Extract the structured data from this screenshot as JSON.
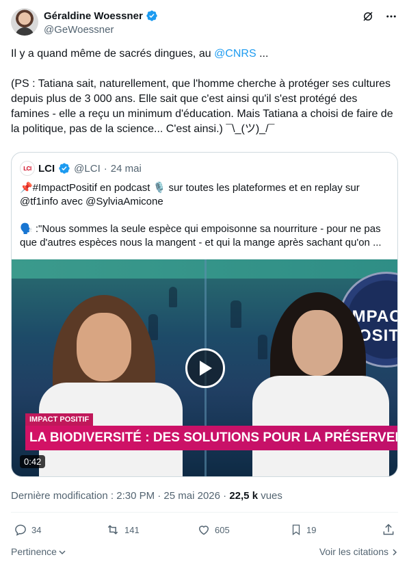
{
  "author": {
    "name": "Géraldine Woessner",
    "handle": "@GeWoessner"
  },
  "tweet": {
    "text_prefix": "Il y a quand même de sacrés dingues, au ",
    "mention": "@CNRS",
    "text_suffix": " ...",
    "paragraph2": "(PS : Tatiana sait, naturellement, que l'homme cherche à protéger ses cultures depuis plus de 3 000 ans. Elle sait que c'est ainsi qu'il s'est protégé des famines - elle a reçu un minimum d'éducation. Mais Tatiana a choisi de faire de la politique, pas de la science... C'est ainsi.) ¯\\_(ツ)_/¯"
  },
  "quote": {
    "logo_text": "LCI",
    "name": "LCI",
    "handle": "@LCI",
    "date": "24 mai",
    "line1": "📌#ImpactPositif en podcast 🎙️ sur toutes les plateformes et en replay sur",
    "line2": "@tf1info avec @SylviaAmicone",
    "line3": "🗣️ :\"Nous sommes la seule espèce qui empoisonne sa nourriture - pour ne pas",
    "line4": "que d'autres espèces nous la mangent - et qui la mange après sachant qu'on ...",
    "video": {
      "brand_line1": "IMPACT",
      "brand_line2": "POSIT",
      "tag": "IMPACT POSITIF",
      "banner": "LA BIODIVERSITÉ : DES SOLUTIONS POUR LA PRÉSERVER",
      "duration": "0:42"
    }
  },
  "meta": {
    "timestamp_text": "Dernière modification : 2:30 PM · 25 mai 2026 · ",
    "views_count": "22,5 k",
    "views_label": " vues"
  },
  "actions": {
    "replies": "34",
    "reposts": "141",
    "likes": "605",
    "bookmarks": "19"
  },
  "footer": {
    "relevance": "Pertinence",
    "quotes_link": "Voir les citations"
  },
  "colors": {
    "accent": "#1d9bf0",
    "muted": "#536471",
    "banner": "#d31265"
  }
}
